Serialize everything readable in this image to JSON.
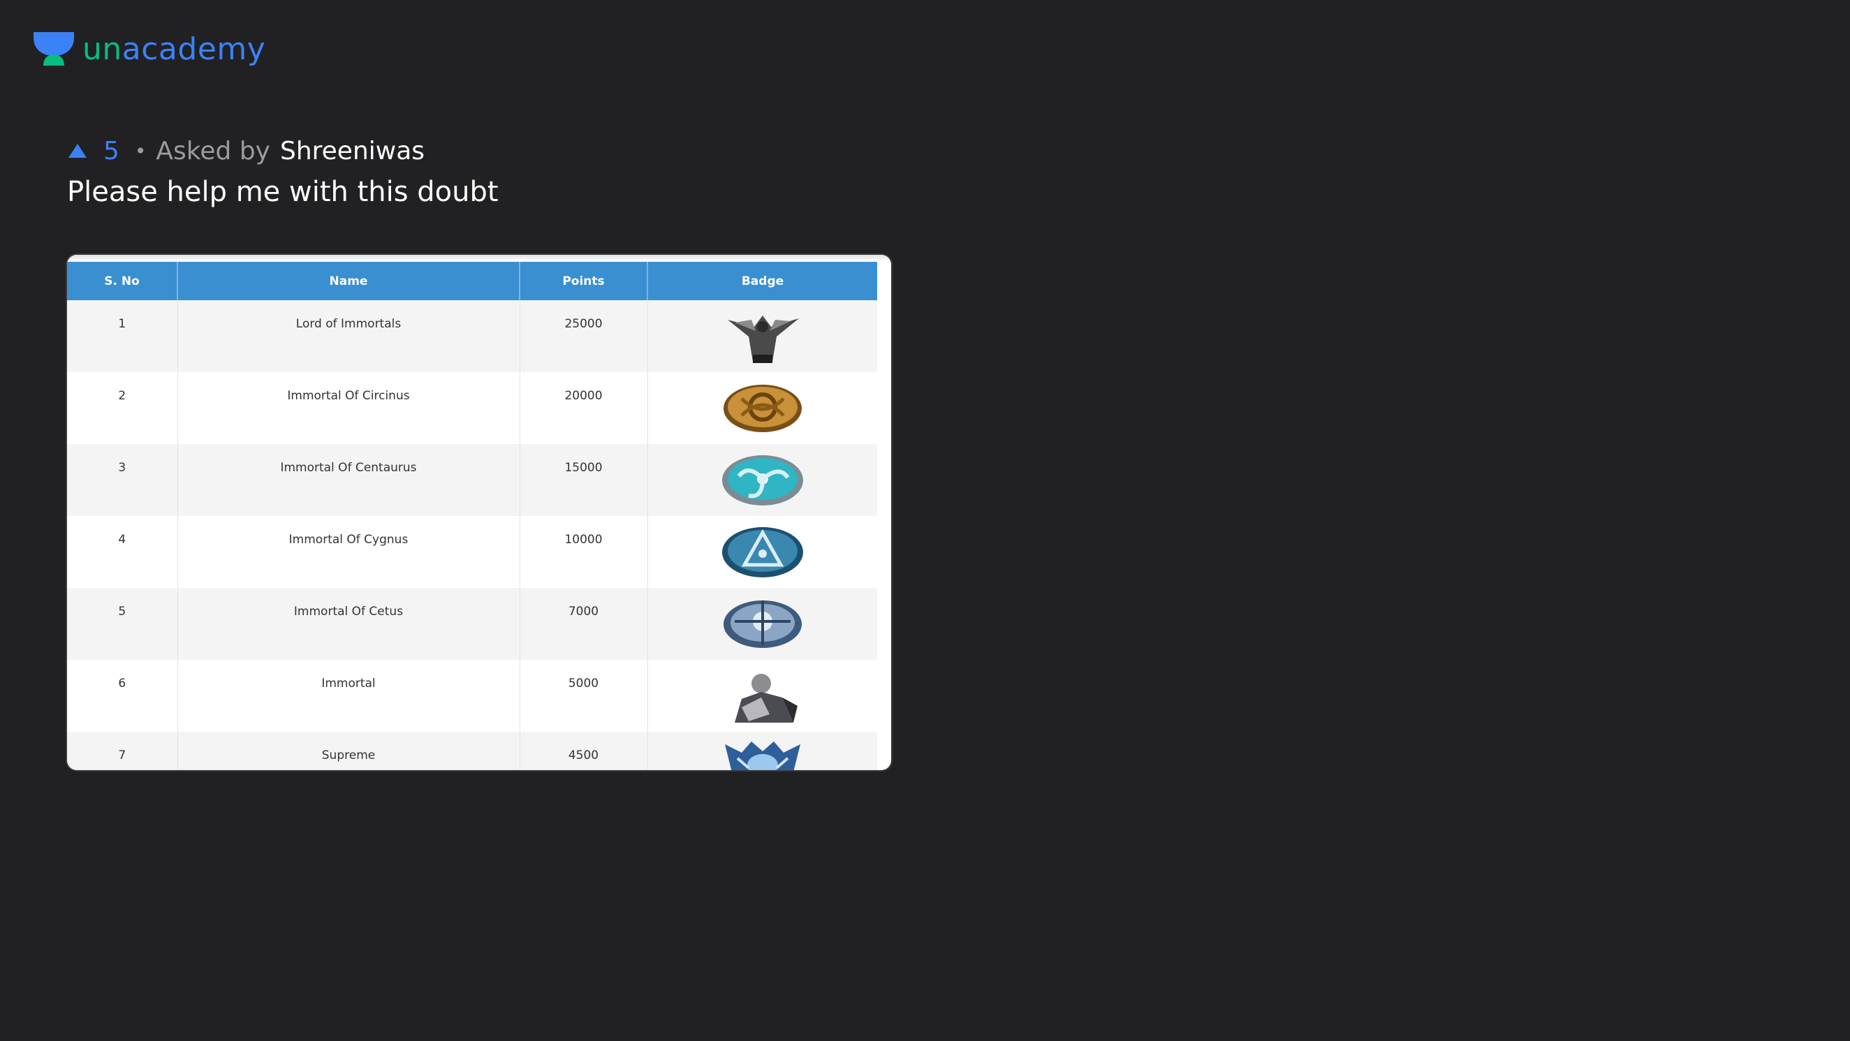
{
  "brand": {
    "name_prefix": "un",
    "name_suffix": "academy"
  },
  "question": {
    "upvotes": "5",
    "separator": "•",
    "asked_prefix": "Asked by",
    "author": "Shreeniwas",
    "title": "Please help me with this doubt"
  },
  "table": {
    "headers": {
      "sno": "S. No",
      "name": "Name",
      "points": "Points",
      "badge": "Badge"
    },
    "rows": [
      {
        "sno": "1",
        "name": "Lord of Immortals",
        "points": "25000",
        "badge_icon": "dark-warrior-badge-icon"
      },
      {
        "sno": "2",
        "name": "Immortal Of Circinus",
        "points": "20000",
        "badge_icon": "gold-knot-badge-icon"
      },
      {
        "sno": "3",
        "name": "Immortal Of Centaurus",
        "points": "15000",
        "badge_icon": "teal-swirl-badge-icon"
      },
      {
        "sno": "4",
        "name": "Immortal Of Cygnus",
        "points": "10000",
        "badge_icon": "blue-triangle-badge-icon"
      },
      {
        "sno": "5",
        "name": "Immortal Of Cetus",
        "points": "7000",
        "badge_icon": "silver-emblem-badge-icon"
      },
      {
        "sno": "6",
        "name": "Immortal",
        "points": "5000",
        "badge_icon": "armored-knight-badge-icon"
      },
      {
        "sno": "7",
        "name": "Supreme",
        "points": "4500",
        "badge_icon": "blue-crest-badge-icon"
      }
    ]
  },
  "colors": {
    "background": "#212123",
    "brand_green": "#08bd80",
    "brand_blue": "#3b82f6",
    "table_header": "#3a8fd0"
  }
}
